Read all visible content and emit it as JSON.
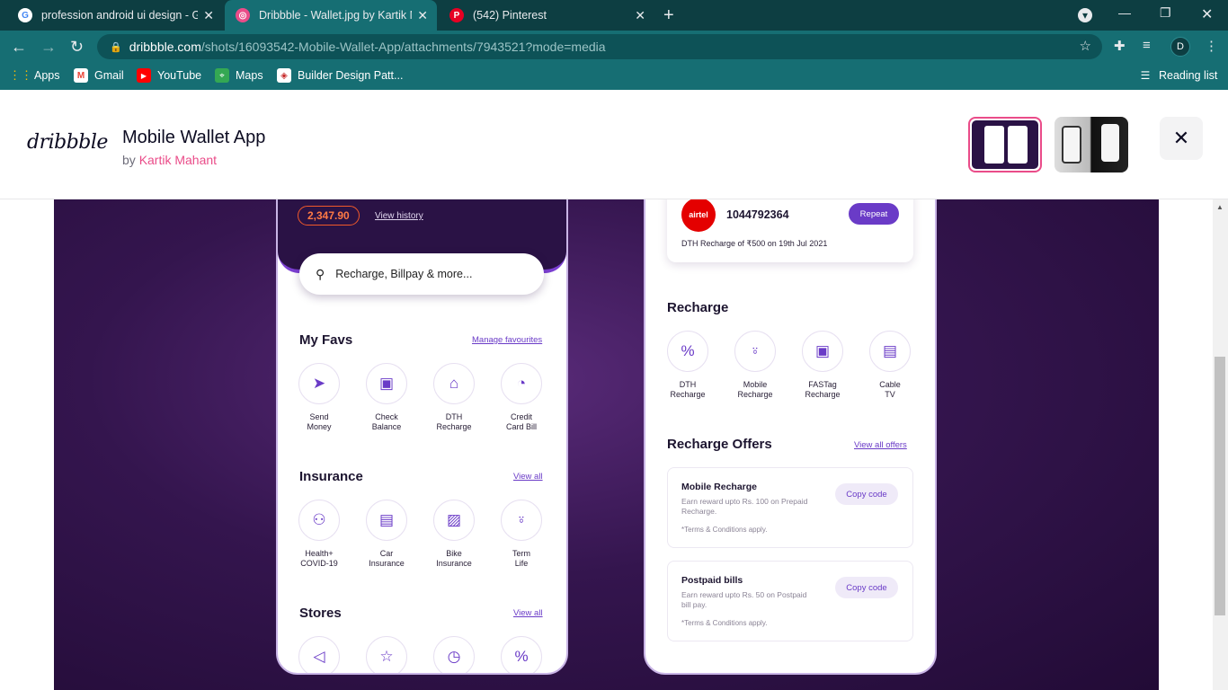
{
  "browser": {
    "tabs": [
      {
        "title": "profession android ui design - Go",
        "favicon": "google-icon"
      },
      {
        "title": "Dribbble - Wallet.jpg by Kartik M",
        "favicon": "dribbble-icon"
      },
      {
        "title": "(542) Pinterest",
        "favicon": "pinterest-icon"
      }
    ],
    "url_domain": "dribbble.com",
    "url_path": "/shots/16093542-Mobile-Wallet-App/attachments/7943521?mode=media",
    "avatar_letter": "D",
    "bookmarks": [
      "Apps",
      "Gmail",
      "YouTube",
      "Maps",
      "Builder Design Patt..."
    ],
    "reading_list": "Reading list"
  },
  "header": {
    "logo": "dribbble",
    "title": "Mobile Wallet App",
    "by": "by",
    "author": "Kartik Mahant"
  },
  "phone_left": {
    "amount": "2,347.90",
    "view_history": "View history",
    "search_placeholder": "Recharge, Billpay & more...",
    "favs": {
      "title": "My Favs",
      "link": "Manage favourites",
      "items": [
        {
          "l1": "Send",
          "l2": "Money",
          "icon": "send-icon"
        },
        {
          "l1": "Check",
          "l2": "Balance",
          "icon": "wallet-icon"
        },
        {
          "l1": "DTH",
          "l2": "Recharge",
          "icon": "home-icon"
        },
        {
          "l1": "Credit",
          "l2": "Card Bill",
          "icon": "pie-chart-icon"
        }
      ]
    },
    "insurance": {
      "title": "Insurance",
      "link": "View all",
      "items": [
        {
          "l1": "Health+",
          "l2": "COVID-19",
          "icon": "person-icon"
        },
        {
          "l1": "Car",
          "l2": "Insurance",
          "icon": "document-icon"
        },
        {
          "l1": "Bike",
          "l2": "Insurance",
          "icon": "image-icon"
        },
        {
          "l1": "Term",
          "l2": "Life",
          "icon": "microphone-icon"
        }
      ]
    },
    "stores": {
      "title": "Stores",
      "link": "View all",
      "icons": [
        "megaphone-icon",
        "star-icon",
        "clock-icon",
        "discount-icon"
      ]
    }
  },
  "phone_right": {
    "last_recharge": {
      "operator": "airtel",
      "number": "1044792364",
      "button": "Repeat",
      "desc": "DTH Recharge of ₹500 on 19th Jul 2021"
    },
    "recharge": {
      "title": "Recharge",
      "items": [
        {
          "l1": "DTH",
          "l2": "Recharge",
          "icon": "discount-icon"
        },
        {
          "l1": "Mobile",
          "l2": "Recharge",
          "icon": "microphone-icon"
        },
        {
          "l1": "FASTag",
          "l2": "Recharge",
          "icon": "wallet-icon"
        },
        {
          "l1": "Cable",
          "l2": "TV",
          "icon": "document-icon"
        }
      ]
    },
    "offers": {
      "title": "Recharge Offers",
      "link": "View all offers",
      "cards": [
        {
          "title": "Mobile Recharge",
          "desc": "Earn reward upto Rs. 100 on Prepaid Recharge.",
          "terms": "*Terms & Conditions apply.",
          "button": "Copy code"
        },
        {
          "title": "Postpaid bills",
          "desc": "Earn reward upto Rs. 50 on Postpaid bill pay.",
          "terms": "*Terms & Conditions apply.",
          "button": "Copy code"
        }
      ]
    }
  }
}
